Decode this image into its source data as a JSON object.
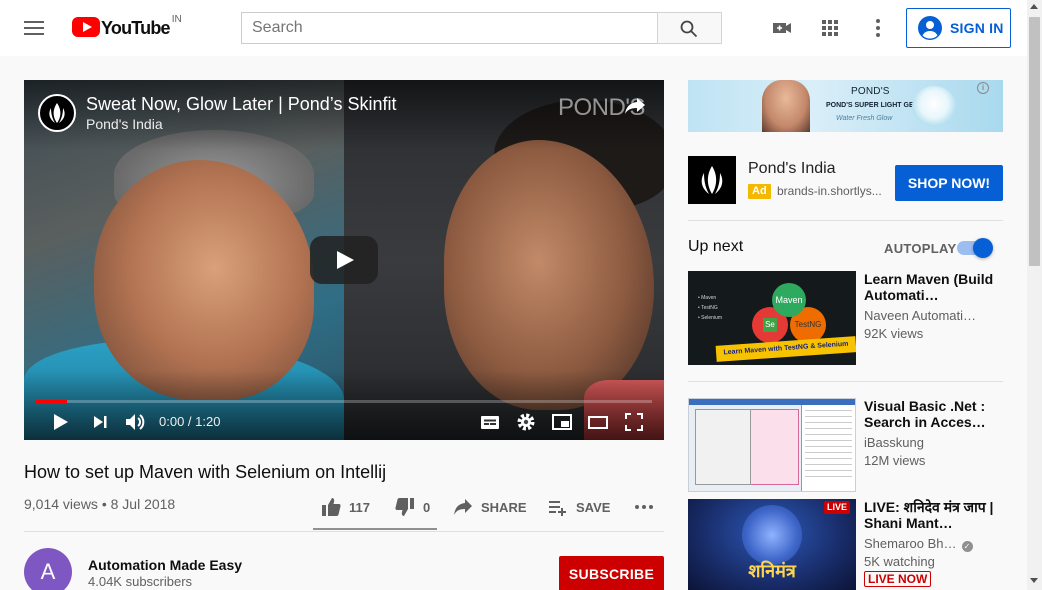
{
  "header": {
    "logo_text": "YouTube",
    "region": "IN",
    "search_placeholder": "Search",
    "signin_label": "SIGN IN"
  },
  "player": {
    "video_title": "Sweat Now, Glow Later | Pond’s Skinfit",
    "channel": "Pond's India",
    "watermark": "POND'S",
    "time": "0:00 / 1:20",
    "progress": 0.05
  },
  "video": {
    "title": "How to set up Maven with Selenium on Intellij",
    "meta": "9,014 views • 8 Jul 2018",
    "likes": "117",
    "dislikes": "0",
    "share_label": "SHARE",
    "save_label": "SAVE",
    "like_ratio": 1.0
  },
  "owner": {
    "avatar_letter": "A",
    "name": "Automation Made Easy",
    "subscribers": "4.04K subscribers",
    "subscribe_label": "SUBSCRIBE"
  },
  "banner_ad": {
    "brand": "POND'S",
    "line": "POND'S SUPER LIGHT GEL",
    "tagline": "Water Fresh Glow",
    "info_icon": "info-icon"
  },
  "sidebar_ad": {
    "name": "Pond's India",
    "badge": "Ad",
    "url": "brands-in.shortlys...",
    "cta": "SHOP NOW!"
  },
  "upnext": {
    "heading": "Up next",
    "autoplay_label": "AUTOPLAY",
    "autoplay_on": true
  },
  "recommendations": [
    {
      "title": "Learn Maven (Build Automati…",
      "channel": "Naveen Automati…",
      "views": "92K views",
      "thumb": {
        "bullets": [
          "Maven",
          "TestNG",
          "Selenium"
        ],
        "maven": "Maven",
        "se": "Se",
        "testng": "TestNG",
        "strip": "Learn Maven with TestNG & Selenium"
      }
    },
    {
      "title": "Visual Basic .Net : Search in Acces…",
      "channel": "iBasskung",
      "views": "12M views"
    },
    {
      "title": "LIVE: शनिदेव मंत्र जाप | Shani Mant…",
      "channel": "Shemaroo Bh…",
      "views": "5K watching",
      "live_label": "LIVE NOW",
      "thumb": {
        "hindi": "शनिमंत्र",
        "live": "LIVE"
      }
    }
  ]
}
